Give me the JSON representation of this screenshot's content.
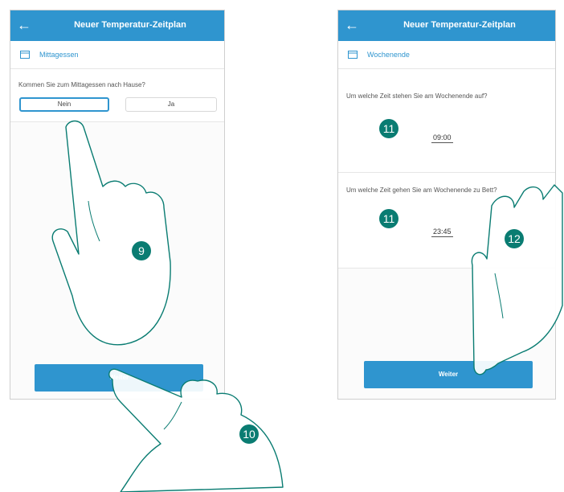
{
  "screens": [
    {
      "header": {
        "back_icon": "back-arrow-icon",
        "title": "Neuer Temperatur-Zeitplan"
      },
      "section": {
        "icon": "calendar-icon",
        "label": "Mittagessen"
      },
      "question": "Kommen Sie zum Mittagessen nach Hause?",
      "options": [
        {
          "label": "Nein",
          "selected": true
        },
        {
          "label": "Ja",
          "selected": false
        }
      ],
      "button_label": "Weiter"
    },
    {
      "header": {
        "back_icon": "back-arrow-icon",
        "title": "Neuer Temperatur-Zeitplan"
      },
      "section": {
        "icon": "calendar-icon",
        "label": "Wochenende"
      },
      "wake": {
        "question": "Um welche Zeit stehen Sie am Wochenende auf?",
        "time": "09:00"
      },
      "sleep": {
        "question": "Um welche Zeit gehen Sie am Wochenende zu Bett?",
        "time": "23:45"
      },
      "button_label": "Weiter"
    }
  ],
  "callouts": [
    "9",
    "10",
    "11",
    "11",
    "12"
  ],
  "colors": {
    "accent": "#2f95cf",
    "callout": "#0a7c72",
    "hand_outline": "#0a7c72"
  }
}
